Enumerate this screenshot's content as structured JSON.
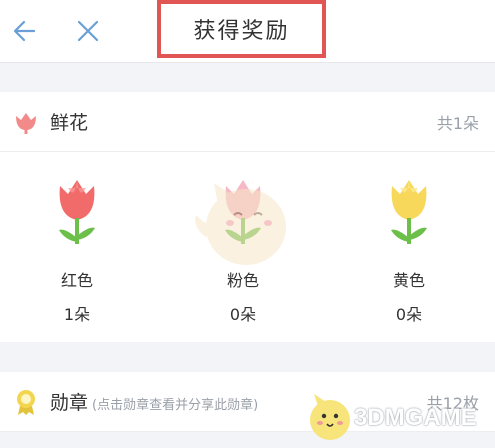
{
  "header": {
    "title": "获得奖励",
    "back_icon": "back-arrow-icon",
    "close_icon": "close-icon"
  },
  "flowers_section": {
    "title": "鲜花",
    "count": "共1朵",
    "icon": "tulip-icon",
    "items": [
      {
        "name": "红色",
        "count": "1朵",
        "color": "#f26b6b"
      },
      {
        "name": "粉色",
        "count": "0朵",
        "color": "#f5b8c4"
      },
      {
        "name": "黄色",
        "count": "0朵",
        "color": "#f7d85a"
      }
    ]
  },
  "medals_section": {
    "title": "勋章",
    "hint": "(点击勋章查看并分享此勋章)",
    "count": "共12枚",
    "icon": "medal-icon"
  },
  "watermark": {
    "logo_text": "3DMGAME"
  },
  "colors": {
    "highlight_border": "#e25555",
    "accent_blue": "#5b9bd5",
    "muted_text": "#9aa0a8"
  }
}
